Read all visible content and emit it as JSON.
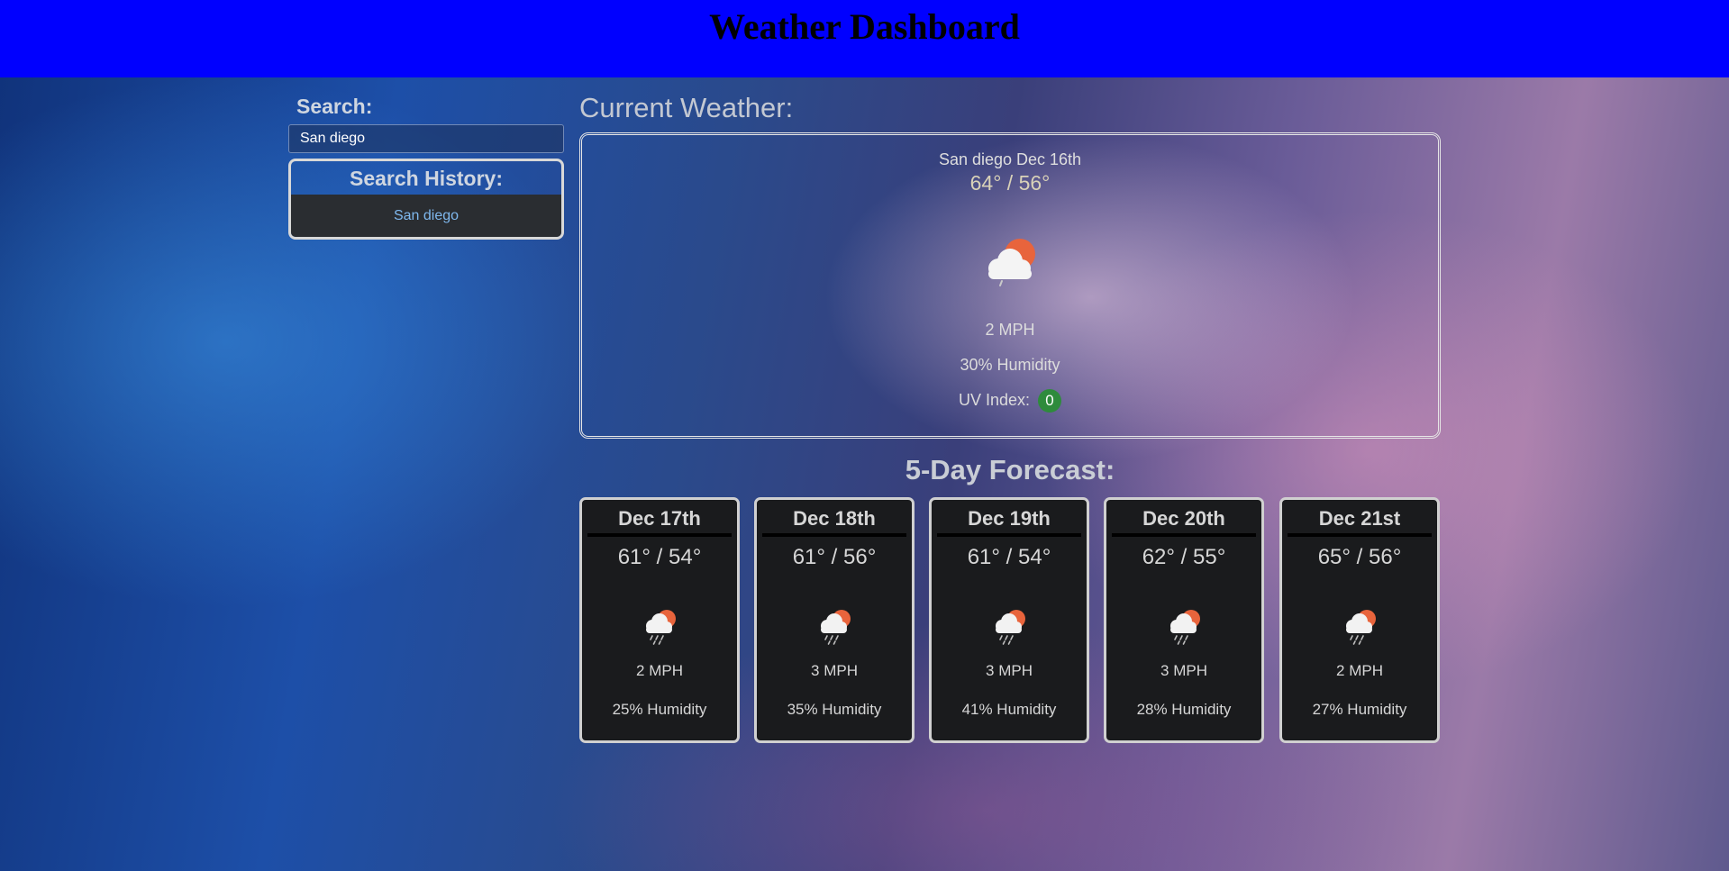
{
  "header": {
    "title": "Weather Dashboard"
  },
  "search": {
    "label": "Search:",
    "value": "San diego"
  },
  "history": {
    "title": "Search History:",
    "items": [
      "San diego"
    ]
  },
  "current": {
    "label": "Current Weather:",
    "city_date": "San diego Dec 16th",
    "temp": "64° / 56°",
    "icon": "partly-cloudy-day-icon",
    "wind": "2 MPH",
    "humidity": "30% Humidity",
    "uv_label": "UV Index:",
    "uv_value": "0",
    "uv_color": "#2e8b3c"
  },
  "forecast": {
    "label": "5-Day Forecast:",
    "days": [
      {
        "date": "Dec 17th",
        "temp": "61° / 54°",
        "icon": "rain-sun-icon",
        "wind": "2 MPH",
        "humidity": "25% Humidity"
      },
      {
        "date": "Dec 18th",
        "temp": "61° / 56°",
        "icon": "rain-sun-icon",
        "wind": "3 MPH",
        "humidity": "35% Humidity"
      },
      {
        "date": "Dec 19th",
        "temp": "61° / 54°",
        "icon": "rain-sun-icon",
        "wind": "3 MPH",
        "humidity": "41% Humidity"
      },
      {
        "date": "Dec 20th",
        "temp": "62° / 55°",
        "icon": "rain-sun-icon",
        "wind": "3 MPH",
        "humidity": "28% Humidity"
      },
      {
        "date": "Dec 21st",
        "temp": "65° / 56°",
        "icon": "rain-sun-icon",
        "wind": "2 MPH",
        "humidity": "27% Humidity"
      }
    ]
  },
  "colors": {
    "header_bg": "#0000ff",
    "card_bg": "#1a1b1d",
    "sun": "#e8643c"
  }
}
